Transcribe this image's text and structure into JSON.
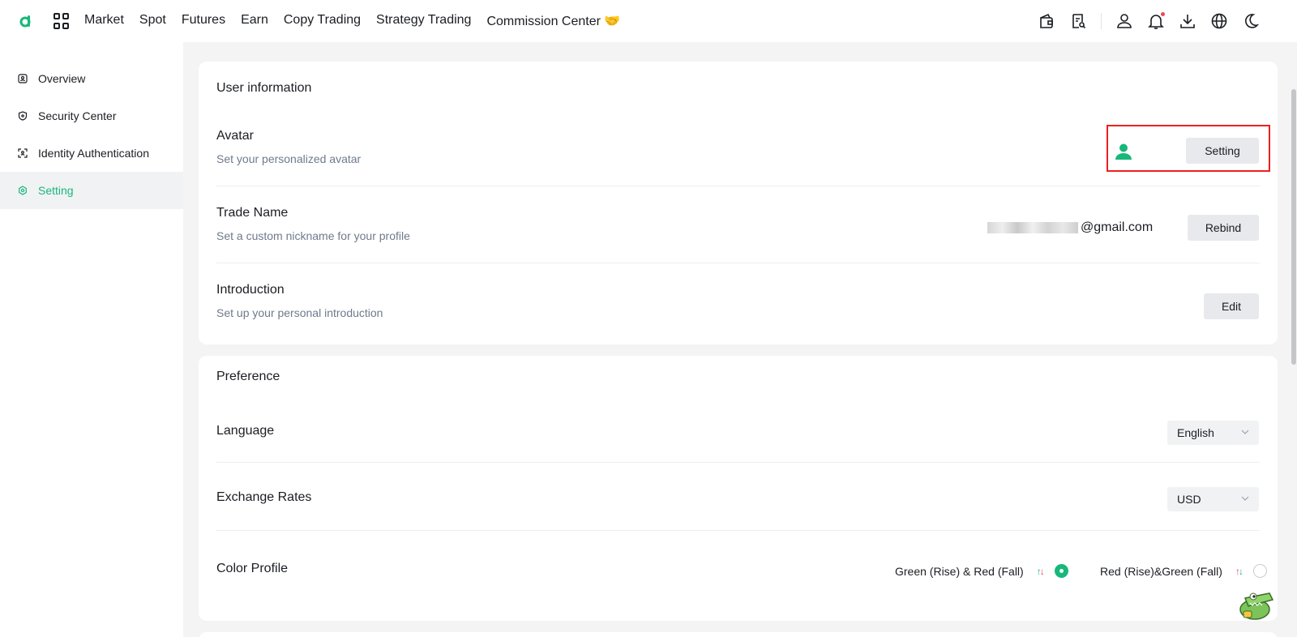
{
  "header": {
    "logo_icon": "brand-logo-icon",
    "nav": [
      "Market",
      "Spot",
      "Futures",
      "Earn",
      "Copy Trading",
      "Strategy Trading",
      "Commission Center"
    ],
    "commission_emoji": "🤝",
    "right_icons": [
      "wallet-icon",
      "orders-icon",
      "user-icon",
      "bell-icon",
      "download-icon",
      "globe-icon",
      "moon-icon"
    ]
  },
  "sidebar": {
    "items": [
      {
        "label": "Overview",
        "icon": "overview-icon"
      },
      {
        "label": "Security Center",
        "icon": "shield-icon"
      },
      {
        "label": "Identity Authentication",
        "icon": "identity-scan-icon"
      },
      {
        "label": "Setting",
        "icon": "gear-icon"
      }
    ],
    "active": "Setting"
  },
  "user_info": {
    "title": "User information",
    "avatar": {
      "title": "Avatar",
      "subtitle": "Set your personalized avatar",
      "button": "Setting"
    },
    "trade_name": {
      "title": "Trade Name",
      "subtitle": "Set a custom nickname for your profile",
      "email_suffix": "@gmail.com",
      "button": "Rebind"
    },
    "introduction": {
      "title": "Introduction",
      "subtitle": "Set up your personal introduction",
      "button": "Edit"
    }
  },
  "preference": {
    "title": "Preference",
    "language": {
      "title": "Language",
      "value": "English"
    },
    "exchange_rates": {
      "title": "Exchange Rates",
      "value": "USD"
    },
    "color_profile": {
      "title": "Color Profile",
      "options": [
        "Green (Rise) & Red (Fall)",
        "Red (Rise)&Green (Fall)"
      ],
      "selected": "Green (Rise) & Red (Fall)"
    }
  },
  "colors": {
    "accent": "#18b77a",
    "highlight_border": "#ee1f1f",
    "negative": "#f0475b"
  }
}
